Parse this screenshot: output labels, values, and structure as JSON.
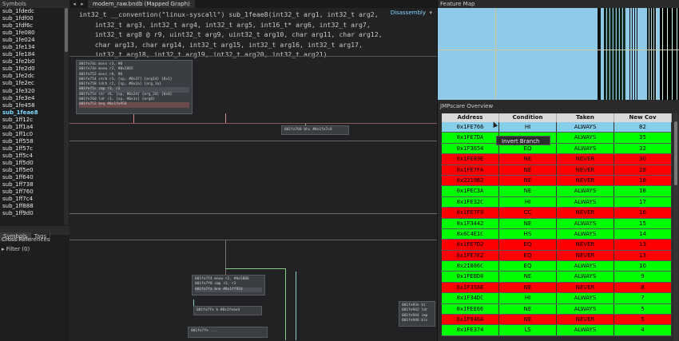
{
  "sidebar": {
    "title": "Symbols",
    "symbols": [
      "sub_1fdedc",
      "sub_1fdf00",
      "sub_1fdf6c",
      "sub_1fe080",
      "sub_1fe024",
      "sub_1fe134",
      "sub_1fe184",
      "sub_1fe2b0",
      "sub_1fe2d0",
      "sub_1fe2dc",
      "sub_1fe2ec",
      "sub_1fe320",
      "sub_1fe3e4",
      "sub_1fe458",
      "sub_1feae8",
      "sub_1ff12c",
      "sub_1ff1a4",
      "sub_1ff1c0",
      "sub_1ff558",
      "sub_1ff57c",
      "sub_1ff5c4",
      "sub_1ff5d0",
      "sub_1ff5e0",
      "sub_1ff640",
      "sub_1ff738",
      "sub_1ff760",
      "sub_1ff7c4",
      "sub_1ff888",
      "sub_1ff9d0"
    ],
    "active_symbol": "sub_1feae8",
    "tabs": [
      "Symbols",
      "Tags"
    ],
    "xref_title": "Cross References",
    "filter_label": "Filter (0)"
  },
  "graph": {
    "tab_label": "modem_raw.bndb (Mapped Graph)",
    "nav_back": "◂",
    "nav_fwd": "▸",
    "view_label": "Disassembly",
    "view_caret": "▾",
    "signature_lines": [
      "int32_t __convention(\"linux-syscall\") sub_1feae8(int32_t arg1, int32_t arg2,",
      "    int32_t arg3, int32_t arg4, int32_t arg5, int16_t* arg6, int32_t arg7,",
      "    int32_t arg8 @ r9, uint32_t arg9, uint32_t arg10, char arg11, char arg12,",
      "    char arg13, char arg14, int32_t arg15, int32_t arg16, int32_t arg17,",
      "    int32_t arg18, int32_t arg19, int32_t arg20, int32_t arg21)"
    ],
    "block1": [
      "001fe74c  movs    r3, #0",
      "001fe74e  movw    r2, #0x5865",
      "001fe752  movs    r0, #0",
      "001fe754  strb    r3, [sp, #0x37] {arg14}  {0x1}",
      "001fe758  ldrh    r2, [sp, #0x1a] {arg_1a}",
      "001fe75c  cmp     r3, r2",
      "001fe75e  str     r6, [sp, #0x24] {arg_24}  {0x0}",
      "001fe760  ldr     r3, [sp, #0x1c] {arg8}",
      "001fe752  beq     #0x1fe958"
    ],
    "block2": [
      "001fe760  bhi     #0x1fe7c8"
    ],
    "block3": [
      "001fe7f4  movw    r2, #0x5886",
      "001fe7f8  cmp     r3, r2",
      "001fe7fa  bne     #0x1ff910"
    ],
    "block4": [
      "001fe7fe  b       #0x1feae4"
    ],
    "block5": [
      "001fe93e  bl",
      "001fe942  ldr",
      "001fe944  cmp",
      "001fe946  bls"
    ],
    "block6": [
      "001fe7fe  ..."
    ]
  },
  "feature_map": {
    "title": "Feature Map"
  },
  "jmpscare": {
    "title": "JMPscare Overview",
    "headers": [
      "Address",
      "Condition",
      "Taken",
      "New Cov"
    ],
    "colors": {
      "always": "#00ff00",
      "never": "#ff0000",
      "selected": "#87ceeb"
    },
    "rows": [
      {
        "address": "0x1FE766",
        "condition": "HI",
        "taken": "ALWAYS",
        "new_cov": "82",
        "state": "selected"
      },
      {
        "address": "0x1FE7DA",
        "condition": "",
        "taken": "ALWAYS",
        "new_cov": "35",
        "state": "always"
      },
      {
        "address": "0x1F3654",
        "condition": "EQ",
        "taken": "ALWAYS",
        "new_cov": "32",
        "state": "always"
      },
      {
        "address": "0x1FE89E",
        "condition": "NE",
        "taken": "NEVER",
        "new_cov": "30",
        "state": "never"
      },
      {
        "address": "0x1FE7FA",
        "condition": "NE",
        "taken": "NEVER",
        "new_cov": "28",
        "state": "never"
      },
      {
        "address": "0x2219B2",
        "condition": "NE",
        "taken": "NEVER",
        "new_cov": "18",
        "state": "never"
      },
      {
        "address": "0x1FEC3A",
        "condition": "NE",
        "taken": "ALWAYS",
        "new_cov": "18",
        "state": "always"
      },
      {
        "address": "0x1FE32C",
        "condition": "HI",
        "taken": "ALWAYS",
        "new_cov": "17",
        "state": "always"
      },
      {
        "address": "0x1FE7F0",
        "condition": "CC",
        "taken": "NEVER",
        "new_cov": "16",
        "state": "never"
      },
      {
        "address": "0x1F3442",
        "condition": "NE",
        "taken": "ALWAYS",
        "new_cov": "15",
        "state": "always"
      },
      {
        "address": "0x6C4E1C",
        "condition": "HS",
        "taken": "ALWAYS",
        "new_cov": "14",
        "state": "always"
      },
      {
        "address": "0x1FE7D2",
        "condition": "EQ",
        "taken": "NEVER",
        "new_cov": "13",
        "state": "never"
      },
      {
        "address": "0x1FE7E2",
        "condition": "EQ",
        "taken": "NEVER",
        "new_cov": "13",
        "state": "never"
      },
      {
        "address": "0x21806C",
        "condition": "EQ",
        "taken": "ALWAYS",
        "new_cov": "10",
        "state": "always"
      },
      {
        "address": "0x1FEBD0",
        "condition": "NE",
        "taken": "ALWAYS",
        "new_cov": "9",
        "state": "always"
      },
      {
        "address": "0x1F358E",
        "condition": "NE",
        "taken": "NEVER",
        "new_cov": "8",
        "state": "never"
      },
      {
        "address": "0x1F34DC",
        "condition": "HI",
        "taken": "ALWAYS",
        "new_cov": "7",
        "state": "always"
      },
      {
        "address": "0x1FEE66",
        "condition": "NE",
        "taken": "ALWAYS",
        "new_cov": "5",
        "state": "always"
      },
      {
        "address": "0x1F946A",
        "condition": "NE",
        "taken": "NEVER",
        "new_cov": "5",
        "state": "never"
      },
      {
        "address": "0x1FE374",
        "condition": "LS",
        "taken": "ALWAYS",
        "new_cov": "4",
        "state": "always"
      }
    ],
    "context_menu_item": "Invert Branch"
  }
}
